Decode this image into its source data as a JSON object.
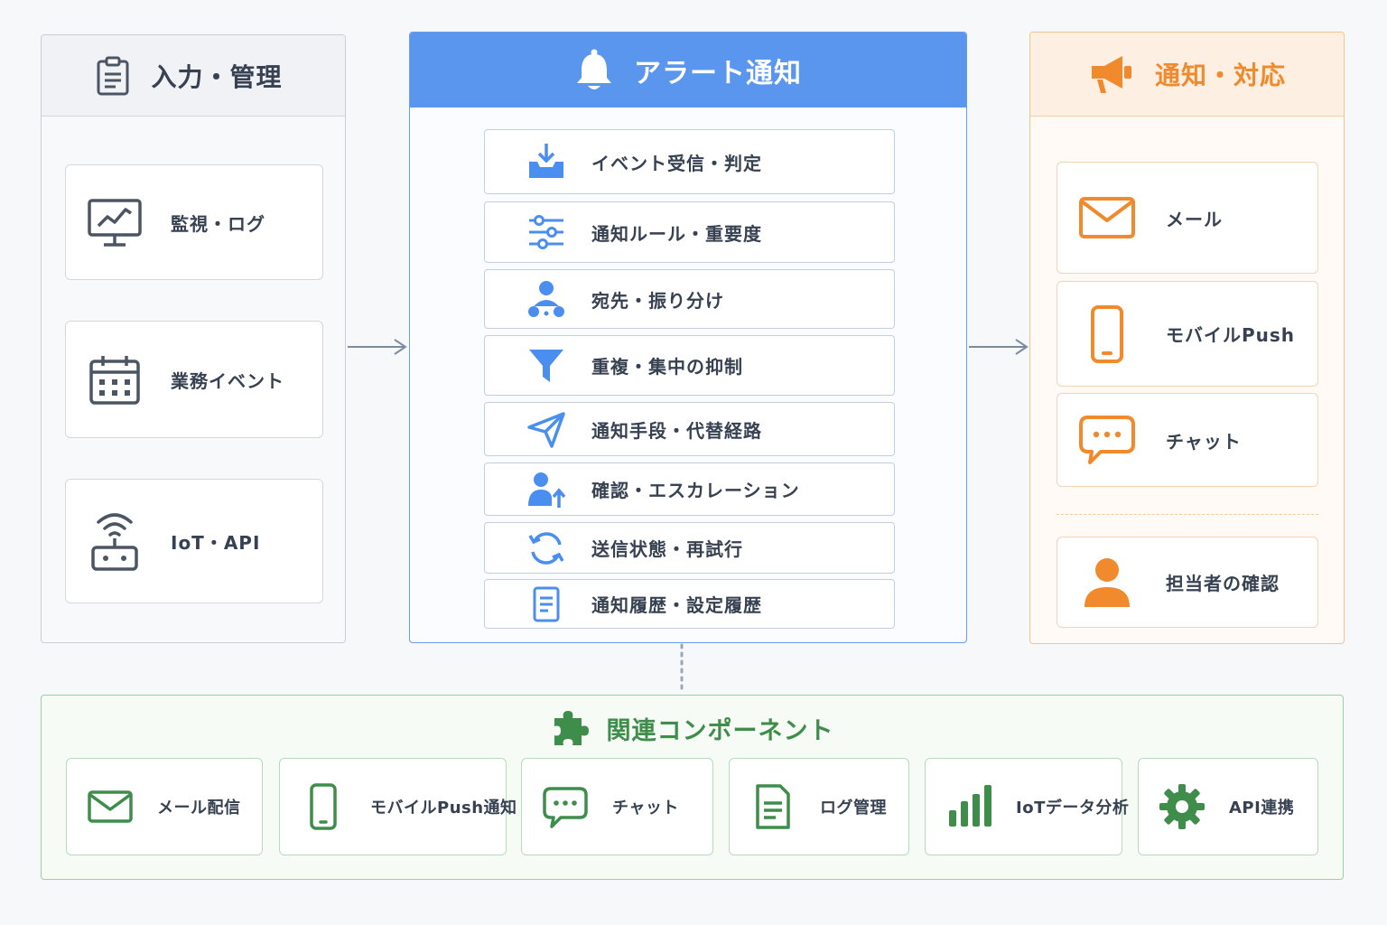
{
  "input_panel": {
    "title": "入力・管理",
    "items": [
      {
        "label": "監視・ログ",
        "icon": "monitor-icon"
      },
      {
        "label": "業務イベント",
        "icon": "calendar-icon"
      },
      {
        "label": "IoT・API",
        "icon": "router-icon"
      }
    ]
  },
  "alert_panel": {
    "title": "アラート通知",
    "steps": [
      {
        "label": "イベント受信・判定",
        "icon": "inbox-download-icon"
      },
      {
        "label": "通知ルール・重要度",
        "icon": "sliders-icon"
      },
      {
        "label": "宛先・振り分け",
        "icon": "user-network-icon"
      },
      {
        "label": "重複・集中の抑制",
        "icon": "filter-icon"
      },
      {
        "label": "通知手段・代替経路",
        "icon": "send-icon"
      },
      {
        "label": "確認・エスカレーション",
        "icon": "user-escalate-icon"
      },
      {
        "label": "送信状態・再試行",
        "icon": "refresh-icon"
      },
      {
        "label": "通知履歴・設定履歴",
        "icon": "document-icon"
      }
    ]
  },
  "output_panel": {
    "title": "通知・対応",
    "items": [
      {
        "label": "メール",
        "icon": "mail-icon"
      },
      {
        "label": "モバイルPush",
        "icon": "smartphone-icon"
      },
      {
        "label": "チャット",
        "icon": "chat-icon"
      }
    ],
    "responder": {
      "label": "担当者の確認",
      "icon": "person-icon"
    }
  },
  "components_panel": {
    "title": "関連コンポーネント",
    "items": [
      {
        "label": "メール配信",
        "icon": "mail-icon"
      },
      {
        "label": "モバイルPush通知",
        "icon": "smartphone-icon"
      },
      {
        "label": "チャット",
        "icon": "chat-icon"
      },
      {
        "label": "ログ管理",
        "icon": "document-icon"
      },
      {
        "label": "IoTデータ分析",
        "icon": "bar-chart-icon"
      },
      {
        "label": "API連携",
        "icon": "gear-icon"
      }
    ]
  },
  "colors": {
    "input": "#6b7280",
    "alert": "#5b96ee",
    "output": "#f08a2c",
    "components": "#3f8d4a"
  }
}
